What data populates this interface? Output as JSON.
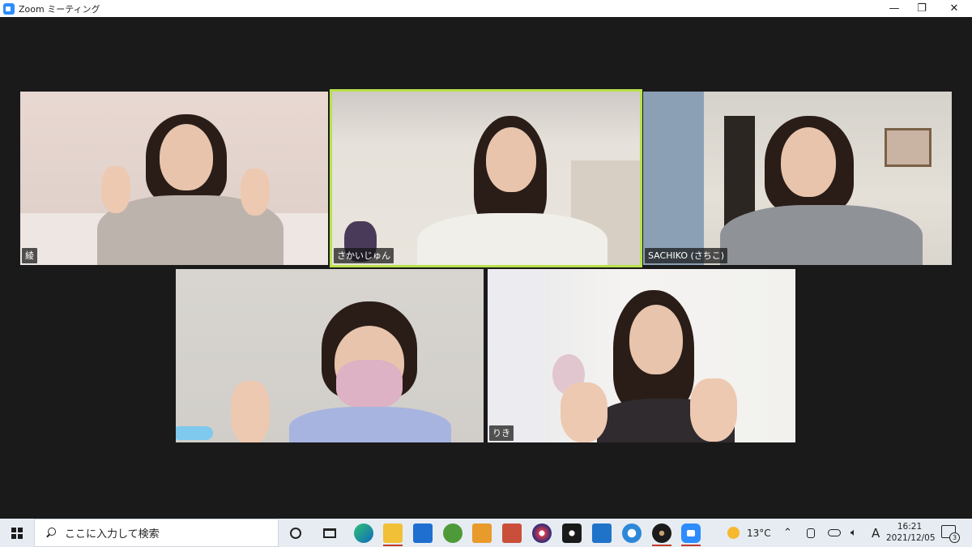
{
  "window": {
    "title": "Zoom ミーティング",
    "minimize_glyph": "—",
    "maximize_glyph": "❐",
    "close_glyph": "✕"
  },
  "participants": [
    {
      "name": "綾",
      "active_speaker": false
    },
    {
      "name": "さかいじゅん",
      "active_speaker": true
    },
    {
      "name": "SACHIKO (さちこ)",
      "active_speaker": false
    },
    {
      "name": "",
      "active_speaker": false
    },
    {
      "name": "りき",
      "active_speaker": false
    }
  ],
  "taskbar": {
    "search_placeholder": "ここに入力して検索",
    "apps": [
      "cortana-icon",
      "task-view-icon",
      "edge-icon",
      "file-explorer-icon",
      "store-icon",
      "app-green-icon",
      "app-video-icon",
      "app-paint-icon",
      "app-color-icon",
      "app-eye-icon",
      "mail-icon",
      "ie-icon",
      "app-disc-icon",
      "zoom-icon"
    ],
    "weather": {
      "temp": "13°C"
    },
    "ime": "A",
    "clock": {
      "time": "16:21",
      "date": "2021/12/05"
    },
    "notification_count": "3"
  },
  "colors": {
    "active_speaker_border": "#b8e14a",
    "zoom_blue": "#2d8cff",
    "background": "#1a1a1a"
  }
}
